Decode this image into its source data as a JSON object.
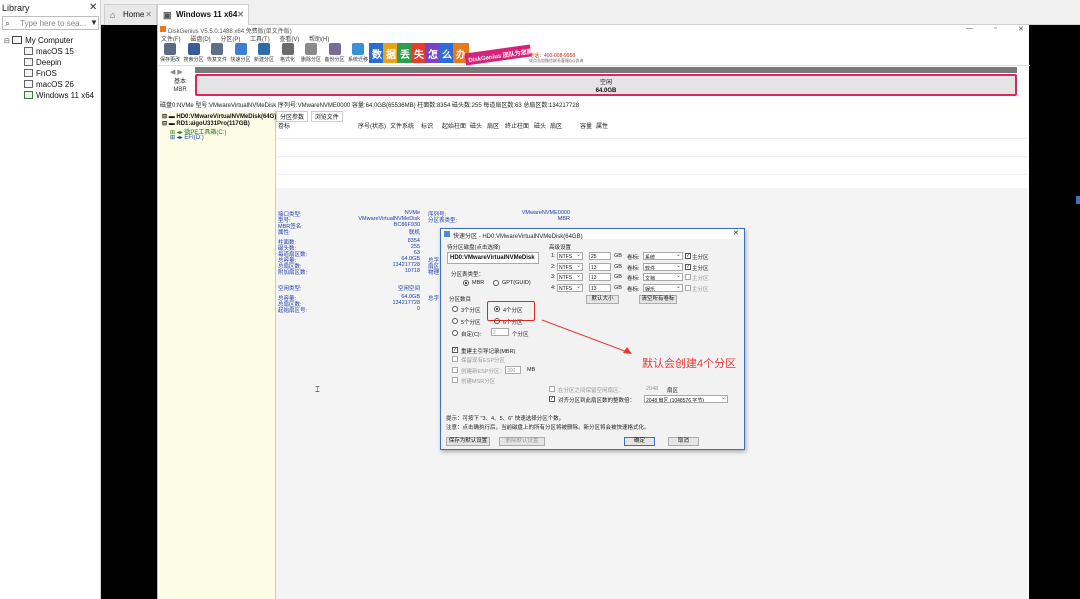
{
  "library": {
    "title": "Library",
    "close": "✕",
    "search_placeholder": "Type here to sea...",
    "tree": [
      {
        "label": "My Computer"
      },
      {
        "label": "macOS 15"
      },
      {
        "label": "Deepin"
      },
      {
        "label": "FnOS"
      },
      {
        "label": "macOS 26"
      },
      {
        "label": "Windows 11 x64"
      }
    ]
  },
  "tabs": [
    {
      "label": "Home",
      "close": "✕"
    },
    {
      "label": "Windows 11 x64",
      "close": "✕"
    }
  ],
  "dg": {
    "title": "DiskGenius V5.5.0.1488 x64 免费版(单文件版)",
    "window_controls": [
      "—",
      "▫",
      "✕"
    ],
    "menu": [
      "文件(F)",
      "磁盘(D)",
      "分区(P)",
      "工具(T)",
      "查看(V)",
      "帮助(H)"
    ],
    "toolbar": [
      {
        "label": "保存更改",
        "icon": "save-icon",
        "color": "#5b6b86"
      },
      {
        "label": "搜索分区",
        "icon": "search-partition-icon",
        "color": "#3a5d9a"
      },
      {
        "label": "恢复文件",
        "icon": "recover-icon",
        "color": "#5e6f8a"
      },
      {
        "label": "快速分区",
        "icon": "quick-partition-icon",
        "color": "#3f7fd1"
      },
      {
        "label": "新建分区",
        "icon": "new-partition-icon",
        "color": "#2c6ca8"
      },
      {
        "label": "格式化",
        "icon": "format-icon",
        "color": "#6b6b6b"
      },
      {
        "label": "删除分区",
        "icon": "delete-partition-icon",
        "color": "#8a8a8a"
      },
      {
        "label": "备份分区",
        "icon": "backup-icon",
        "color": "#7a6a9a"
      },
      {
        "label": "系统迁移",
        "icon": "migrate-icon",
        "color": "#3a8fd9"
      }
    ],
    "ad": {
      "chars": [
        "数",
        "据",
        "丢",
        "失",
        "怎",
        "么",
        "办"
      ],
      "colors": [
        "#2b6cd8",
        "#e8a317",
        "#2e9e4e",
        "#e43f2c",
        "#7b42c8",
        "#2b6cd8",
        "#e8791d"
      ],
      "ribbon": "DiskGenius 团队为您服务",
      "phone": "电话：400-008-9958",
      "sub": "或点击加微信联系客服QQ咨询"
    },
    "disk_nav": "◀ ▶",
    "disk_basic": [
      "基本",
      "MBR"
    ],
    "disk_map": {
      "label": "空闲",
      "size": "64.0GB"
    },
    "disk_info": "磁盘0:NVMe  型号:VMwareVirtualNVMeDisk  序列号:VMwareNVME0000  容量:64.0GB(65536MB)  柱面数:8354  磁头数:255  每道扇区数:63  总扇区数:134217728",
    "tree": [
      "HD0:VMwareVirtualNVMeDisk(64G)",
      "RD1:aigoU331Pro(117GB)",
      "微PE工具箱(C:)",
      "EFI(D:)"
    ],
    "right_tabs": [
      "分区参数",
      "浏览文件"
    ],
    "columns": [
      "卷标",
      "序号(状态)",
      "文件系统",
      "标识",
      "起始柱面",
      "磁头",
      "扇区",
      "终止柱面",
      "磁头",
      "扇区",
      "容量",
      "属性"
    ],
    "info_left": [
      {
        "label": "接口类型:",
        "value": "NVMe"
      },
      {
        "label": "型号:",
        "value": "VMwareVirtualNVMeDisk"
      },
      {
        "label": "MBR签名:",
        "value": "BC86F930"
      },
      {
        "label": "属性:",
        "value": "联机"
      },
      {
        "label": "柱面数:",
        "value": "8354"
      },
      {
        "label": "磁头数:",
        "value": "255"
      },
      {
        "label": "每道扇区数:",
        "value": "63"
      },
      {
        "label": "总容量:",
        "value": "64.0GB"
      },
      {
        "label": "总扇区数:",
        "value": "134217728"
      },
      {
        "label": "附加扇区数:",
        "value": "10718"
      },
      {
        "label": "空闲类型:",
        "value": "空闲空间"
      },
      {
        "label": "总容量:",
        "value": "64.0GB"
      },
      {
        "label": "总扇区数:",
        "value": "134217728"
      },
      {
        "label": "起始扇区号:",
        "value": "0"
      }
    ],
    "info_right": [
      {
        "label": "序列号:",
        "value": "VMwareNVME0000"
      },
      {
        "label": "分区表类型:",
        "value": "MBR"
      },
      {
        "label": "总字",
        "value": ""
      },
      {
        "label": "扇区",
        "value": ""
      },
      {
        "label": "物理",
        "value": ""
      },
      {
        "label": "总字",
        "value": ""
      }
    ]
  },
  "dialog": {
    "title": "快速分区 - HD0:VMwareVirtualNVMeDisk(64GB)",
    "close": "✕",
    "disk_section": "待分区磁盘(点击选择)",
    "disk": "HD0:VMwareVirtualNVMeDisk",
    "pt_type_label": "分区表类型：",
    "pt_options": [
      "MBR",
      "GPT(GUID)"
    ],
    "count_label": "分区数目",
    "counts": [
      "3个分区",
      "4个分区",
      "5个分区",
      "6个分区",
      "自定(C):"
    ],
    "custom_value": "2",
    "custom_unit": "个分区",
    "rebuild_mbr": "重建主引导记录(MBR)",
    "esp_keep": "保留现有ESP分区",
    "esp_create": "创建新ESP分区：",
    "esp_size": "300",
    "esp_unit": "MB",
    "msr_create": "创建MSR分区",
    "advanced_label": "高级设置",
    "rows": [
      {
        "index": "1:",
        "fs": "NTFS",
        "size": "25",
        "unit": "GB",
        "label_title": "卷标:",
        "label": "系统",
        "primary": "主分区"
      },
      {
        "index": "2:",
        "fs": "NTFS",
        "size": "13",
        "unit": "GB",
        "label_title": "卷标:",
        "label": "软件",
        "primary": "主分区"
      },
      {
        "index": "3:",
        "fs": "NTFS",
        "size": "13",
        "unit": "GB",
        "label_title": "卷标:",
        "label": "文档",
        "primary": "主分区"
      },
      {
        "index": "4:",
        "fs": "NTFS",
        "size": "13",
        "unit": "GB",
        "label_title": "卷标:",
        "label": "娱乐",
        "primary": "主分区"
      }
    ],
    "default_size_btn": "默认大小",
    "clear_labels_btn": "清空所有卷标",
    "reserve_label": "在分区之间保留空闲扇区：",
    "reserve_value": "2048",
    "reserve_unit": "扇区",
    "align_label": "对齐分区到此扇区数的整数倍：",
    "align_value": "2048 扇区 (1048576 字节)",
    "tip1": "提示：可按下 \"3、4、5、6\" 快速选择分区个数。",
    "tip2": "注意：点击确执行后，当前磁盘上的所有分区将被删除。新分区将会被快速格式化。",
    "save_default_btn": "保存为默认设置",
    "delete_default_btn": "删除默认设置",
    "ok_btn": "确定",
    "cancel_btn": "取消"
  },
  "annotation": "默认会创建4个分区",
  "colors": {
    "highlight_red": "#e32424",
    "disk_map_border": "#e0245e",
    "annotation_red": "#e63a3a",
    "info_blue": "#1a3da8"
  }
}
